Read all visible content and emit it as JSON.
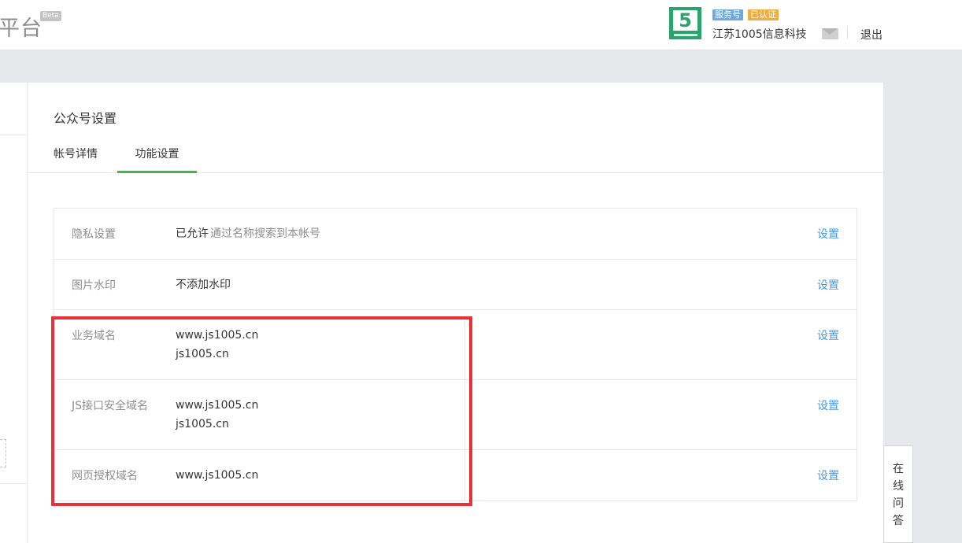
{
  "header": {
    "brand_partial": "平台",
    "beta_label": "Beta",
    "account_logo_text": "5",
    "tag_service": "服务号",
    "tag_verified": "已认证",
    "account_name": "江苏1005信息科技",
    "logout_label": "退出"
  },
  "main": {
    "title": "公众号设置",
    "tabs": [
      {
        "label": "帐号详情",
        "active": false
      },
      {
        "label": "功能设置",
        "active": true
      }
    ],
    "rows": [
      {
        "label": "隐私设置",
        "value_main": "已允许",
        "value_hint": "通过名称搜索到本帐号",
        "action": "设置"
      },
      {
        "label": "图片水印",
        "value_main": "不添加水印",
        "action": "设置"
      },
      {
        "label": "业务域名",
        "values": [
          "www.js1005.cn",
          "js1005.cn"
        ],
        "action": "设置"
      },
      {
        "label": "JS接口安全域名",
        "values": [
          "www.js1005.cn",
          "js1005.cn"
        ],
        "action": "设置"
      },
      {
        "label": "网页授权域名",
        "values": [
          "www.js1005.cn"
        ],
        "action": "设置"
      }
    ]
  },
  "floating": {
    "qa_chars": [
      "在",
      "线",
      "问",
      "答"
    ]
  },
  "colors": {
    "accent_green": "#44b549",
    "link_blue": "#459ae9",
    "highlight_red": "#ea3034"
  }
}
